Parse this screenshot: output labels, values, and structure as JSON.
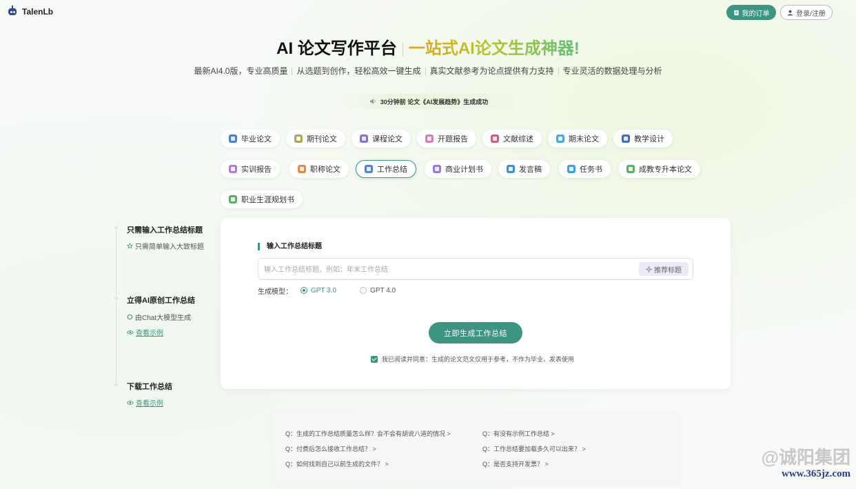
{
  "brand": {
    "name": "TalenLb"
  },
  "header": {
    "orders_label": "我的订单",
    "login_label": "登录/注册"
  },
  "hero": {
    "title_main": "AI 论文写作平台",
    "title_accent": "一站式AI论文生成神器!",
    "subtitles": [
      "最新AI4.0版，专业高质量",
      "从选题到创作，轻松高效一键生成",
      "真实文献参考为论点提供有力支持",
      "专业灵活的数据处理与分析"
    ]
  },
  "notice": {
    "text": "30分钟前 论文《AI发展趋势》生成成功"
  },
  "categories": [
    {
      "label": "毕业论文",
      "color": "#4a7fd8"
    },
    {
      "label": "期刊论文",
      "color": "#a6a55a"
    },
    {
      "label": "课程论文",
      "color": "#8a6fd6"
    },
    {
      "label": "开题报告",
      "color": "#d77ab5"
    },
    {
      "label": "文献综述",
      "color": "#d45a7a"
    },
    {
      "label": "期末论文",
      "color": "#4aa8d8"
    },
    {
      "label": "教学设计",
      "color": "#3e6fb8"
    },
    {
      "label": "实训报告",
      "color": "#b57ad6"
    },
    {
      "label": "职称论文",
      "color": "#e0894a"
    },
    {
      "label": "工作总结",
      "color": "#4a86c8"
    },
    {
      "label": "商业计划书",
      "color": "#9a7ad8"
    },
    {
      "label": "发言稿",
      "color": "#3e8fd0"
    },
    {
      "label": "任务书",
      "color": "#3ea0d8"
    },
    {
      "label": "成教专升本论文",
      "color": "#5ab06a"
    },
    {
      "label": "职业生涯规划书",
      "color": "#5ab06a"
    }
  ],
  "active_category": "工作总结",
  "steps": {
    "s1_title": "只需输入工作总结标题",
    "s1_desc": "只需简单输入大致标题",
    "s2_title": "立得AI原创工作总结",
    "s2_desc": "由Chat大模型生成",
    "s2_link": "查看示例",
    "s3_title": "下载工作总结",
    "s3_link": "查看示例"
  },
  "form": {
    "label": "输入工作总结标题",
    "placeholder": "输入工作总结标题，例如：年末工作总结",
    "suggest_label": "推荐标题",
    "model_label": "生成模型：",
    "model_options": [
      "GPT 3.0",
      "GPT 4.0"
    ],
    "model_selected": "GPT 3.0",
    "generate_label": "立即生成工作总结",
    "agree_text": "我已阅读并同意：生成的论文范文仅用于参考，不作为毕业、发表使用",
    "agree_checked": true
  },
  "faq": [
    "Q：生成的工作总结质量怎么样？会不会有胡说八道的情况 >",
    "Q：有没有示例工作总结 >",
    "Q：付费后怎么接收工作总结？ >",
    "Q：工作总结要加载多久可以出来？ >",
    "Q：如何找到自己以前生成的文件？ >",
    "Q：是否支持开发票？ >"
  ],
  "watermark": {
    "text": "@诚阳集团",
    "url": "www.365jz.com"
  },
  "colors": {
    "accent": "#3d9480"
  }
}
